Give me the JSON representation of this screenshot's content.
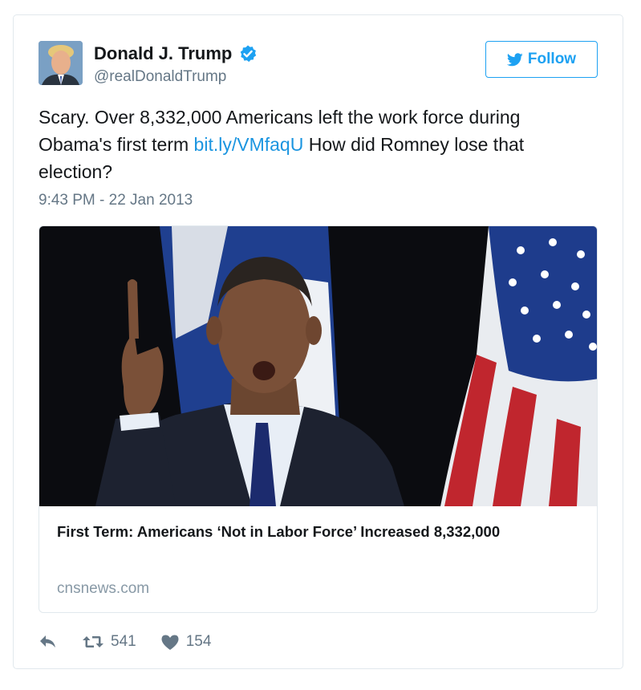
{
  "user": {
    "name": "Donald J. Trump",
    "handle": "@realDonaldTrump",
    "avatar_alt": "profile photo"
  },
  "follow_label": "Follow",
  "tweet": {
    "text_before": "Scary. Over 8,332,000 Americans left the work force during Obama's first term ",
    "link_text": "bit.ly/VMfaqU",
    "text_after": " How did Romney lose that election?",
    "timestamp": "9:43 PM - 22 Jan 2013"
  },
  "card": {
    "title": "First Term: Americans ‘Not in Labor Force’ Increased 8,332,000",
    "domain": "cnsnews.com"
  },
  "stats": {
    "retweets": "541",
    "likes": "154"
  },
  "icons": {
    "verified": "verified-badge-icon",
    "bird": "twitter-bird-icon",
    "reply": "reply-icon",
    "retweet": "retweet-icon",
    "like": "heart-icon"
  },
  "colors": {
    "accent": "#1da1f2",
    "link": "#1b95e0",
    "muted": "#657786",
    "border": "#e1e8ed"
  }
}
